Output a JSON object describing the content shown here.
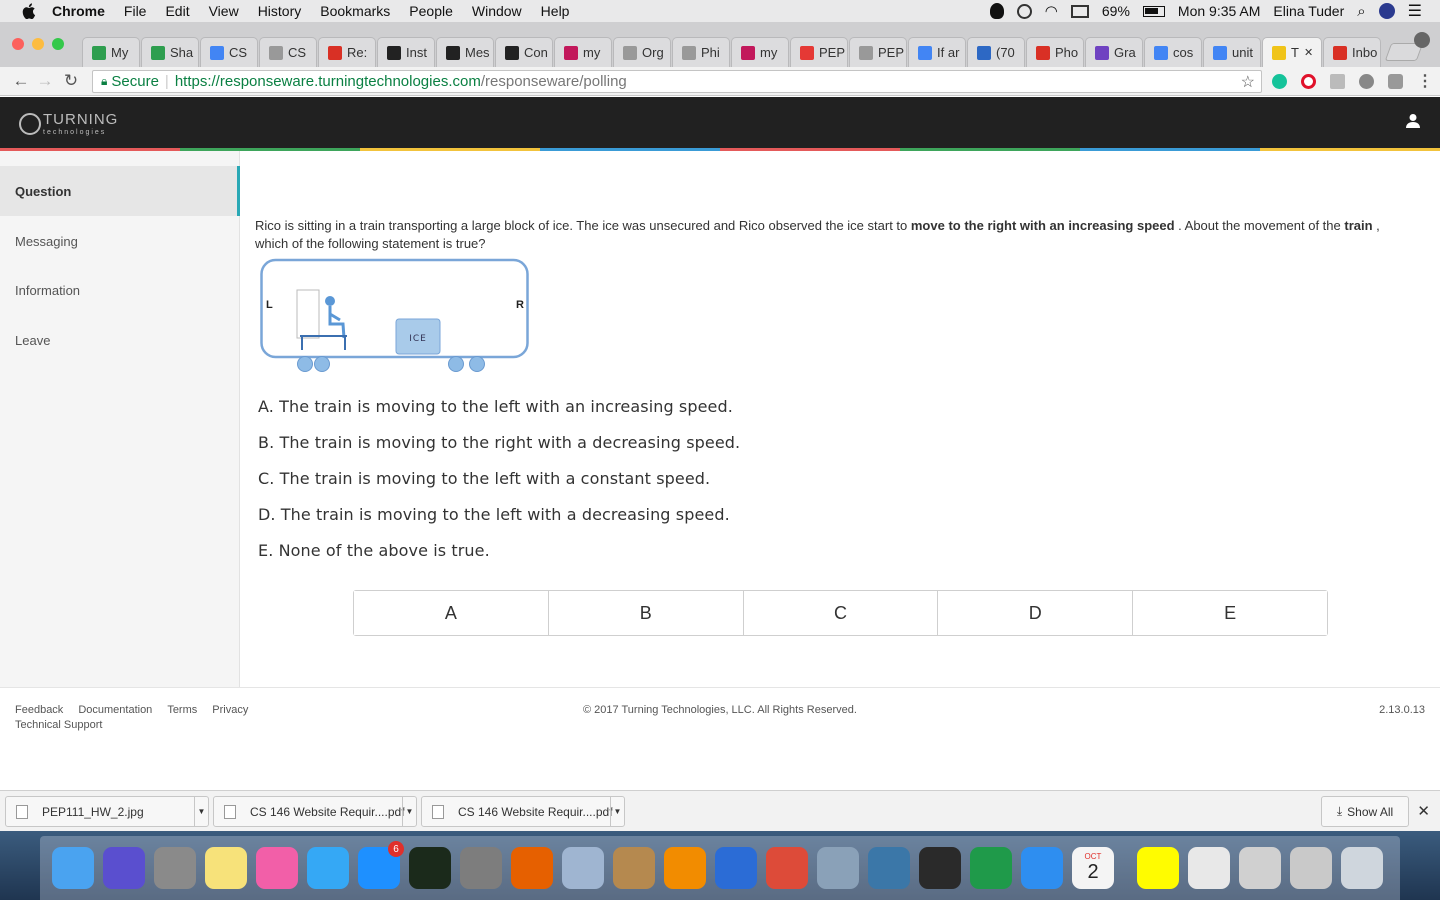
{
  "menubar": {
    "items": [
      "Chrome",
      "File",
      "Edit",
      "View",
      "History",
      "Bookmarks",
      "People",
      "Window",
      "Help"
    ],
    "battery": "69%",
    "clock": "Mon 9:35 AM",
    "user": "Elina Tuder"
  },
  "tabs": [
    {
      "label": "My",
      "icon": "drive-icon",
      "color": "#2e9e4f"
    },
    {
      "label": "Sha",
      "icon": "drive-icon",
      "color": "#2e9e4f"
    },
    {
      "label": "CS",
      "icon": "docs-icon",
      "color": "#4285f4"
    },
    {
      "label": "CS",
      "icon": "page-icon",
      "color": "#999999"
    },
    {
      "label": "Re:",
      "icon": "gmail-icon",
      "color": "#d93025"
    },
    {
      "label": "Inst",
      "icon": "github-icon",
      "color": "#222222"
    },
    {
      "label": "Mes",
      "icon": "github-icon",
      "color": "#222222"
    },
    {
      "label": "Con",
      "icon": "github-icon",
      "color": "#222222"
    },
    {
      "label": "my",
      "icon": "ucla-icon",
      "color": "#c2185b"
    },
    {
      "label": "Org",
      "icon": "page-icon",
      "color": "#999999"
    },
    {
      "label": "Phi",
      "icon": "page-icon",
      "color": "#999999"
    },
    {
      "label": "my",
      "icon": "ucla-icon",
      "color": "#c2185b"
    },
    {
      "label": "PEP",
      "icon": "lifebuoy-icon",
      "color": "#e53935"
    },
    {
      "label": "PEP",
      "icon": "page-icon",
      "color": "#999999"
    },
    {
      "label": "If ar",
      "icon": "google-icon",
      "color": "#4285f4"
    },
    {
      "label": "(70",
      "icon": "ucla-icon",
      "color": "#2d68c4"
    },
    {
      "label": "Pho",
      "icon": "gmail-icon",
      "color": "#d93025"
    },
    {
      "label": "Gra",
      "icon": "gem-icon",
      "color": "#6f42c1"
    },
    {
      "label": "cos",
      "icon": "google-icon",
      "color": "#4285f4"
    },
    {
      "label": "unit",
      "icon": "google-icon",
      "color": "#4285f4"
    },
    {
      "label": "T",
      "icon": "turning-icon",
      "color": "#f0c419",
      "active": true
    },
    {
      "label": "Inbo",
      "icon": "gmail-icon",
      "color": "#d93025"
    }
  ],
  "toolbar": {
    "secure_label": "Secure",
    "url_scheme_host": "https://responseware.turningtechnologies.com",
    "url_path": "/responseware/polling"
  },
  "app": {
    "logo_text": "TURNING",
    "logo_sub": "technologies"
  },
  "sidebar": {
    "items": [
      {
        "label": "Question",
        "active": true
      },
      {
        "label": "Messaging"
      },
      {
        "label": "Information"
      },
      {
        "label": "Leave"
      }
    ]
  },
  "question": {
    "text_pre": "Rico is sitting in a train transporting a large block of ice. The ice was unsecured and Rico observed the ice start to ",
    "text_bold1": "move to the right with an increasing speed",
    "text_mid": " . About the movement of the ",
    "text_bold2": "train",
    "text_post": " , which of the following statement is true?",
    "diagram": {
      "left_label": "L",
      "right_label": "R",
      "ice_label": "ICE"
    },
    "choices": [
      "A. The train is moving to the left with an increasing speed.",
      "B. The train is moving to the right with a decreasing speed.",
      "C. The train is moving to the left with a constant speed.",
      "D. The train is moving to the left with a decreasing speed.",
      "E. None of the above is true."
    ],
    "answer_buttons": [
      "A",
      "B",
      "C",
      "D",
      "E"
    ]
  },
  "footer": {
    "links": [
      "Feedback",
      "Documentation",
      "Terms",
      "Privacy"
    ],
    "support": "Technical Support",
    "copyright": "© 2017 Turning Technologies, LLC. All Rights Reserved.",
    "version": "2.13.0.13"
  },
  "downloads": {
    "items": [
      "PEP111_HW_2.jpg",
      "CS 146 Website Requir....pdf",
      "CS 146 Website Requir....pdf"
    ],
    "show_all": "Show All"
  },
  "dock": {
    "apps": [
      {
        "name": "finder-icon",
        "color": "#4aa3f0"
      },
      {
        "name": "siri-icon",
        "color": "#5a4fcf"
      },
      {
        "name": "calculator-icon",
        "color": "#8a8a8a"
      },
      {
        "name": "notes-icon",
        "color": "#f7e27a"
      },
      {
        "name": "itunes-icon",
        "color": "#f25fa8"
      },
      {
        "name": "messages-icon",
        "color": "#35a8f5"
      },
      {
        "name": "app-store-icon",
        "color": "#1e90ff",
        "badge": "6"
      },
      {
        "name": "activity-monitor-icon",
        "color": "#1b2a1b"
      },
      {
        "name": "system-preferences-icon",
        "color": "#7d7d7d"
      },
      {
        "name": "firefox-icon",
        "color": "#e66000"
      },
      {
        "name": "preview-icon",
        "color": "#9fb5d1"
      },
      {
        "name": "contacts-icon",
        "color": "#b5894f"
      },
      {
        "name": "vlc-icon",
        "color": "#f28c00"
      },
      {
        "name": "word-icon",
        "color": "#2b6cd6"
      },
      {
        "name": "chrome-icon",
        "color": "#dd4b39"
      },
      {
        "name": "image-capture-icon",
        "color": "#8aa1b8"
      },
      {
        "name": "python-icon",
        "color": "#3b77a8"
      },
      {
        "name": "terminal-icon",
        "color": "#2a2a2a"
      },
      {
        "name": "excel-icon",
        "color": "#1f9a4a"
      },
      {
        "name": "safari-icon",
        "color": "#2e8ef0"
      },
      {
        "name": "calendar-icon",
        "color": "#f4f4f4"
      },
      {
        "name": "snapchat-icon",
        "color": "#fffc00"
      },
      {
        "name": "documents-icon",
        "color": "#e8e8e8"
      },
      {
        "name": "chrome-apps-icon",
        "color": "#d0d0d0"
      },
      {
        "name": "downloads-stack-icon",
        "color": "#c9c9c9"
      },
      {
        "name": "trash-icon",
        "color": "#cfd6dd"
      }
    ],
    "calendar_month": "OCT",
    "calendar_day": "2"
  }
}
